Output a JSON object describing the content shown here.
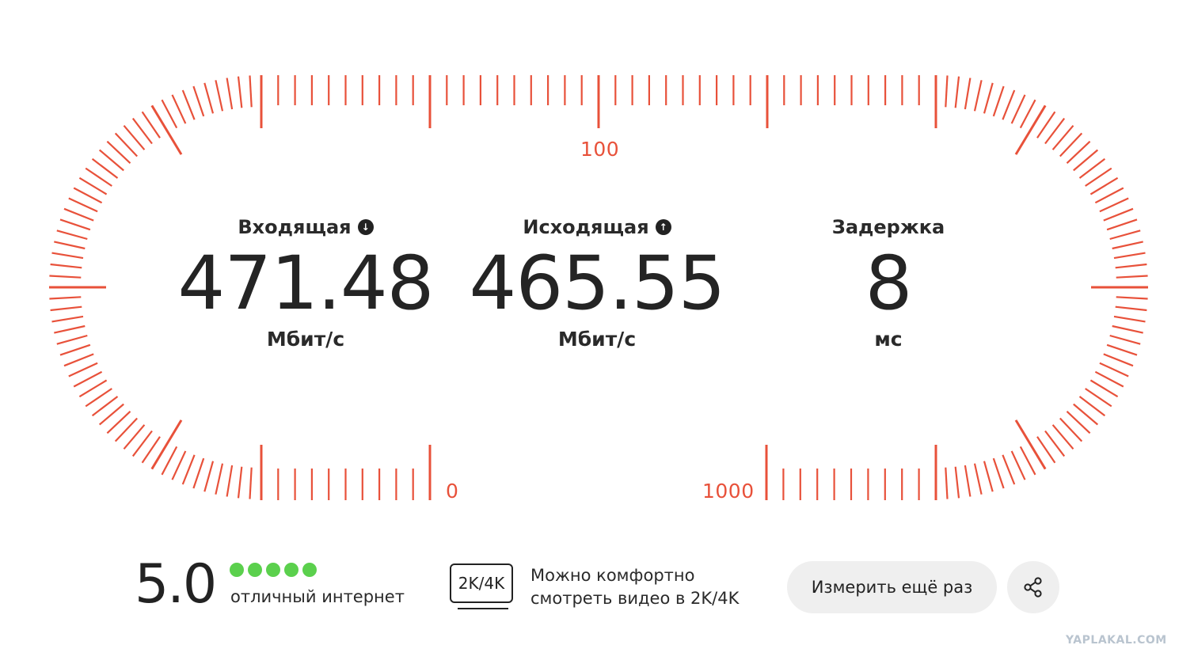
{
  "scale": {
    "color": "#e8513a",
    "labels": {
      "top": "100",
      "bottom_left": "0",
      "bottom_right": "1000"
    }
  },
  "metrics": {
    "download": {
      "title": "Входящая",
      "icon": "arrow-down-circle-icon",
      "value": "471.48",
      "unit": "Мбит/с"
    },
    "upload": {
      "title": "Исходящая",
      "icon": "arrow-up-circle-icon",
      "value": "465.55",
      "unit": "Мбит/с"
    },
    "latency": {
      "title": "Задержка",
      "value": "8",
      "unit": "мс"
    }
  },
  "rating": {
    "score": "5.0",
    "stars_filled": 5,
    "stars_total": 5,
    "dot_color": "#5bd04d",
    "text": "отличный интернет"
  },
  "quality": {
    "badge": "2K/4K",
    "line1": "Можно комфортно",
    "line2": "смотреть видео в 2K/4K"
  },
  "actions": {
    "retest_label": "Измерить ещё раз",
    "share_icon": "share-icon"
  },
  "watermark": "YAPLAKAL.COM"
}
